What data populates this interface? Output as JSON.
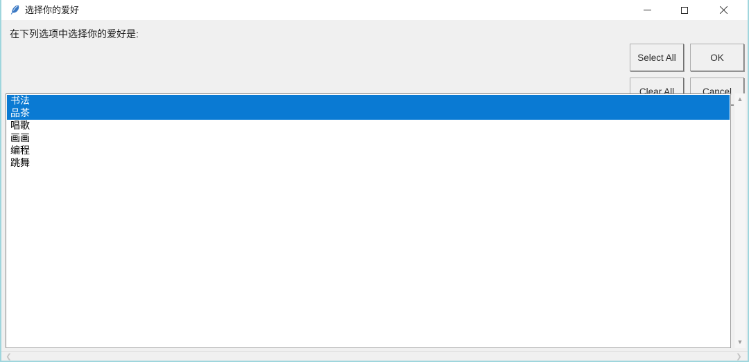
{
  "window": {
    "title": "选择你的爱好",
    "icon": "feather-icon",
    "accent_border_color": "#9fd6dd",
    "titlebar_background": "#ffffff",
    "client_background": "#f0f0f0",
    "controls": {
      "minimize": "minimize-icon",
      "maximize": "maximize-icon",
      "close": "close-icon"
    }
  },
  "main": {
    "prompt": "在下列选项中选择你的爱好是:",
    "buttons": {
      "select_all": "Select All",
      "ok": "OK",
      "clear_all": "Clear All",
      "cancel": "Cancel"
    },
    "listbox": {
      "selection_color": "#0a7ad3",
      "background": "#ffffff",
      "items": [
        {
          "label": "书法",
          "selected": true
        },
        {
          "label": "品茶",
          "selected": true
        },
        {
          "label": "唱歌",
          "selected": false
        },
        {
          "label": "画画",
          "selected": false
        },
        {
          "label": "编程",
          "selected": false
        },
        {
          "label": "跳舞",
          "selected": false
        }
      ]
    },
    "scrollbars": {
      "vertical": {
        "up_arrow": "chevron-up-icon",
        "down_arrow": "chevron-down-icon"
      },
      "horizontal": {
        "left_arrow": "chevron-left-icon",
        "right_arrow": "chevron-right-icon"
      }
    }
  }
}
